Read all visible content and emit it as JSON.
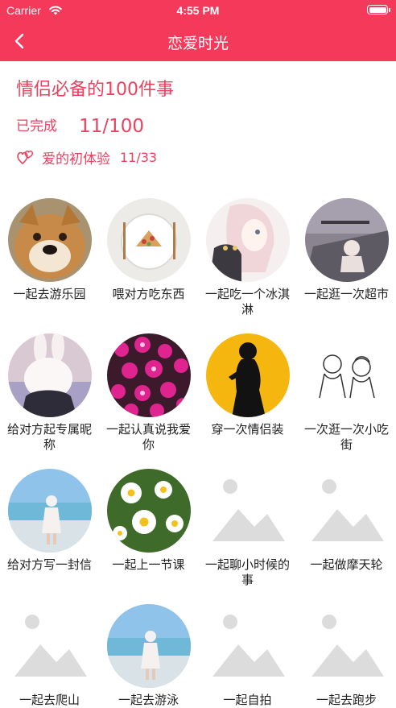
{
  "status_bar": {
    "carrier": "Carrier",
    "time": "4:55 PM"
  },
  "nav": {
    "title": "恋爱时光"
  },
  "header": {
    "title": "情侣必备的100件事",
    "done_label": "已完成",
    "done_count": "11/100",
    "category_label": "爱的初体验",
    "category_count": "11/33"
  },
  "colors": {
    "accent": "#f5395b",
    "text_accent": "#e8425f"
  },
  "items": [
    {
      "label": "一起去游乐园",
      "image": "dog-photo"
    },
    {
      "label": "喂对方吃东西",
      "image": "food-plate-photo"
    },
    {
      "label": "一起吃一个冰淇淋",
      "image": "anime-girl-photo"
    },
    {
      "label": "一起逛一次超市",
      "image": "girl-window-photo"
    },
    {
      "label": "给对方起专属昵称",
      "image": "bunny-hat-photo"
    },
    {
      "label": "一起认真说我爱你",
      "image": "pink-flowers-photo"
    },
    {
      "label": "穿一次情侣装",
      "image": "silhouette-yellow-photo"
    },
    {
      "label": "一次逛一次小吃街",
      "image": "couple-sketch-photo"
    },
    {
      "label": "给对方写一封信",
      "image": "beach-girl-photo"
    },
    {
      "label": "一起上一节课",
      "image": "daisies-photo"
    },
    {
      "label": "一起聊小时候的事",
      "image": "placeholder-image"
    },
    {
      "label": "一起做摩天轮",
      "image": "placeholder-image"
    },
    {
      "label": "一起去爬山",
      "image": "placeholder-image"
    },
    {
      "label": "一起去游泳",
      "image": "beach-girl-photo"
    },
    {
      "label": "一起自拍",
      "image": "placeholder-image"
    },
    {
      "label": "一起去跑步",
      "image": "placeholder-image"
    }
  ]
}
